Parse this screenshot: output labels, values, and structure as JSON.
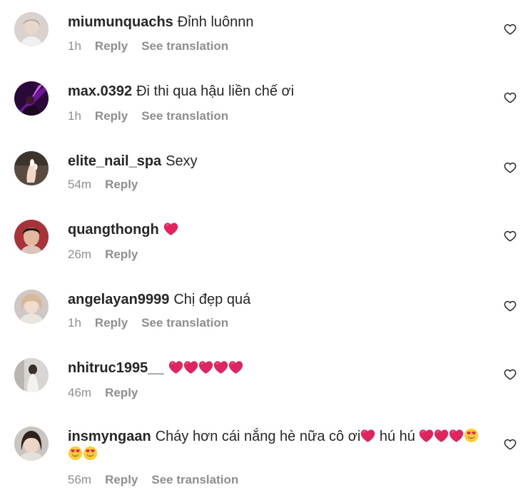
{
  "comments": [
    {
      "username": "miumunquachs",
      "text": "Đỉnh luônnn",
      "time": "1h",
      "reply": "Reply",
      "translate": "See translation"
    },
    {
      "username": "max.0392",
      "text": "Đi thi qua hậu liền chế ơi",
      "time": "1h",
      "reply": "Reply",
      "translate": "See translation"
    },
    {
      "username": "elite_nail_spa",
      "text": "Sexy",
      "time": "54m",
      "reply": "Reply"
    },
    {
      "username": "quangthongh",
      "text": "",
      "emoji": "❤️",
      "time": "26m",
      "reply": "Reply"
    },
    {
      "username": "angelayan9999",
      "text": "Chị đẹp quá",
      "time": "1h",
      "reply": "Reply",
      "translate": "See translation"
    },
    {
      "username": "nhitruc1995__",
      "text": "",
      "emoji": "❤️❤️❤️❤️❤️",
      "time": "46m",
      "reply": "Reply"
    },
    {
      "username": "insmyngaan",
      "text_part1": "Cháy hơn cái nắng hè nữa cô ơi",
      "emoji_part1": "❤️",
      "text_part2": " hú hú ",
      "emoji_part2": "❤️❤️❤️😍😍😍",
      "time": "56m",
      "reply": "Reply",
      "translate": "See translation"
    }
  ],
  "icons": {
    "like": "heart-outline-icon",
    "emoji_heart": "red-heart-emoji",
    "emoji_face": "heart-eyes-emoji"
  },
  "colors": {
    "text": "#262626",
    "meta": "#8e8e8e",
    "heart_emoji": "#e0245e"
  }
}
